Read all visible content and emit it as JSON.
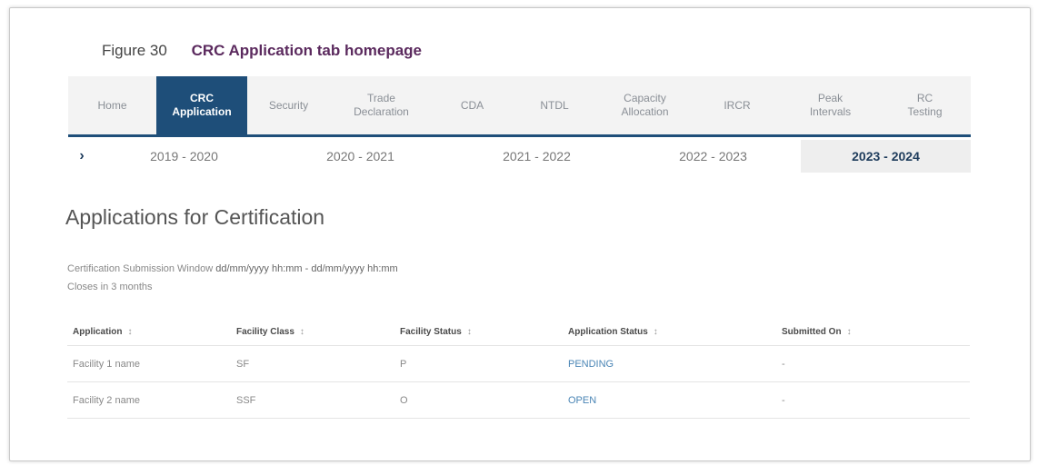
{
  "figure": {
    "number": "Figure 30",
    "title": "CRC Application tab homepage"
  },
  "tabs": [
    {
      "label": "Home"
    },
    {
      "label": "CRC Application",
      "active": true
    },
    {
      "label": "Security"
    },
    {
      "label": "Trade Declaration"
    },
    {
      "label": "CDA"
    },
    {
      "label": "NTDL"
    },
    {
      "label": "Capacity Allocation"
    },
    {
      "label": "IRCR"
    },
    {
      "label": "Peak Intervals"
    },
    {
      "label": "RC Testing"
    }
  ],
  "years": {
    "chevron": "›",
    "items": [
      "2019 - 2020",
      "2020 - 2021",
      "2021 - 2022",
      "2022 - 2023",
      "2023 - 2024"
    ],
    "active": "2023 - 2024"
  },
  "section": {
    "heading": "Applications for Certification",
    "window_label": "Certification Submission Window",
    "window_dates": "dd/mm/yyyy hh:mm - dd/mm/yyyy hh:mm",
    "closes": "Closes in 3 months"
  },
  "table": {
    "columns": [
      "Application",
      "Facility Class",
      "Facility Status",
      "Application Status",
      "Submitted On"
    ],
    "sort_glyph": "↕",
    "rows": [
      {
        "application": "Facility 1 name",
        "class": "SF",
        "facility_status": "P",
        "application_status": "PENDING",
        "submitted": "-"
      },
      {
        "application": "Facility 2 name",
        "class": "SSF",
        "facility_status": "O",
        "application_status": "OPEN",
        "submitted": "-"
      }
    ]
  },
  "colors": {
    "accent": "#1e4e79",
    "caption_title": "#5b2a5e",
    "link": "#4a85b5"
  }
}
